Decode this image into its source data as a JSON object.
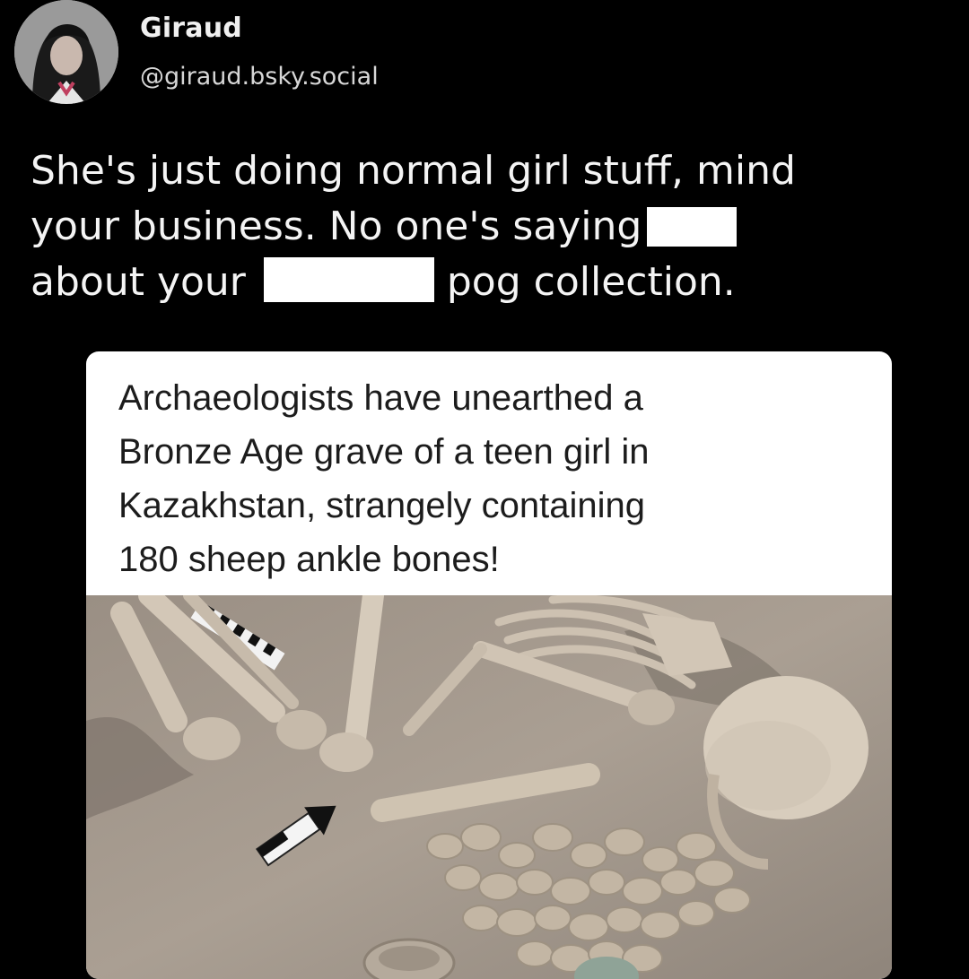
{
  "user": {
    "display_name": "Giraud",
    "handle": "@giraud.bsky.social"
  },
  "post": {
    "line1": "She's just doing normal girl stuff, mind",
    "line2_before": "your business. No one's saying",
    "line3_before": "about your",
    "line3_after": "pog collection."
  },
  "card": {
    "headline_lines": [
      "Archaeologists have unearthed a",
      "Bronze Age grave of a teen girl in",
      "Kazakhstan, strangely containing",
      "180 sheep ankle bones!"
    ]
  }
}
